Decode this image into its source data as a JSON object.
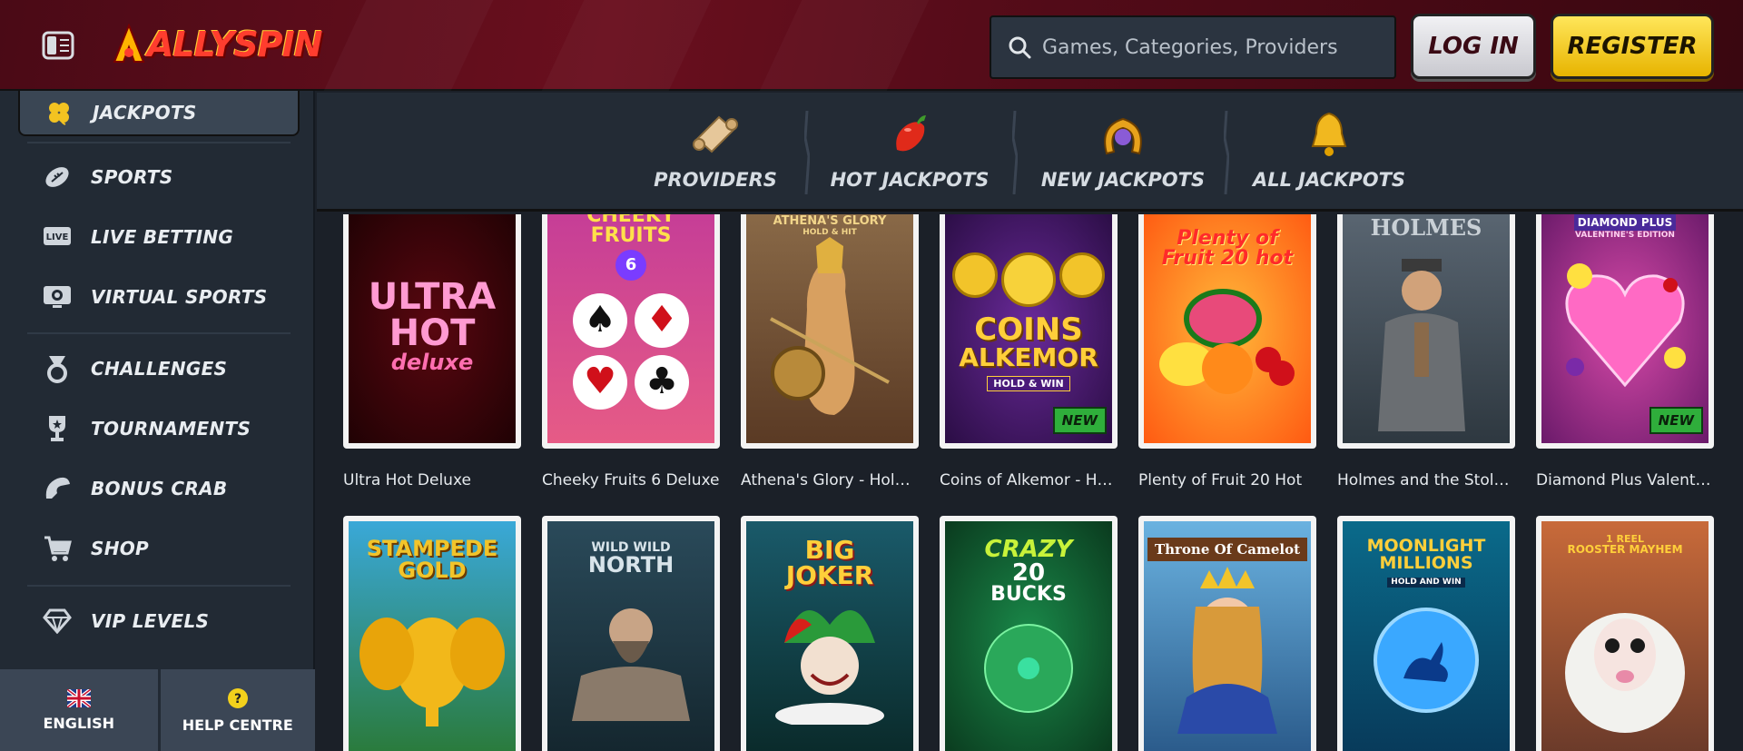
{
  "header": {
    "logo_text": "ALLYSPIN",
    "search_placeholder": "Games, Categories, Providers",
    "login_label": "LOG IN",
    "register_label": "REGISTER"
  },
  "sidebar": {
    "active_item": {
      "label": "JACKPOTS",
      "icon": "clover-icon"
    },
    "items": [
      {
        "label": "SPORTS",
        "icon": "football-icon"
      },
      {
        "label": "LIVE BETTING",
        "icon": "live-icon"
      },
      {
        "label": "VIRTUAL SPORTS",
        "icon": "virtual-sports-icon"
      },
      {
        "label": "CHALLENGES",
        "icon": "medal-icon"
      },
      {
        "label": "TOURNAMENTS",
        "icon": "trophy-icon"
      },
      {
        "label": "BONUS CRAB",
        "icon": "crab-claw-icon"
      },
      {
        "label": "SHOP",
        "icon": "cart-icon"
      },
      {
        "label": "VIP LEVELS",
        "icon": "diamond-icon"
      }
    ],
    "bottom": {
      "language_label": "ENGLISH",
      "help_label": "HELP CENTRE"
    }
  },
  "categories": [
    {
      "label": "PROVIDERS",
      "icon": "scroll-icon"
    },
    {
      "label": "HOT JACKPOTS",
      "icon": "chili-icon"
    },
    {
      "label": "NEW JACKPOTS",
      "icon": "horseshoe-icon"
    },
    {
      "label": "ALL JACKPOTS",
      "icon": "bell-icon"
    }
  ],
  "games_row1": [
    {
      "name": "Ultra Hot Deluxe",
      "art_line1": "ULTRA",
      "art_line2": "HOT",
      "art_line3": "deluxe"
    },
    {
      "name": "Cheeky Fruits 6 Deluxe",
      "art_line1": "CHEEKY",
      "art_line2": "FRUITS",
      "art_line3": "6"
    },
    {
      "name": "Athena's Glory - Hold ...",
      "art_line1": "ATHENA'S GLORY",
      "art_line2": "HOLD & HIT"
    },
    {
      "name": "Coins of Alkemor - HO...",
      "art_line1": "COINS",
      "art_line2": "ALKEMOR",
      "art_line3": "HOLD & WIN",
      "badge": "NEW"
    },
    {
      "name": "Plenty of Fruit 20 Hot",
      "art_line1": "Plenty of",
      "art_line2": "Fruit 20 hot"
    },
    {
      "name": "Holmes and the Stole...",
      "art_line1": "HOLMES"
    },
    {
      "name": "Diamond Plus Valenti...",
      "art_line1": "DIAMOND PLUS",
      "art_line2": "VALENTINE'S EDITION",
      "badge": "NEW"
    }
  ],
  "games_row2": [
    {
      "art_line1": "STAMPEDE",
      "art_line2": "GOLD"
    },
    {
      "art_line1": "WILD WILD",
      "art_line2": "NORTH"
    },
    {
      "art_line1": "BIG",
      "art_line2": "JOKER"
    },
    {
      "art_line1": "CRAZY",
      "art_line2": "20",
      "art_line3": "BUCKS"
    },
    {
      "art_line1": "Throne Of Camelot"
    },
    {
      "art_line1": "MOONLIGHT",
      "art_line2": "MILLIONS",
      "art_line3": "HOLD AND WIN"
    },
    {
      "art_line1": "1 REEL",
      "art_line2": "ROOSTER MAYHEM"
    }
  ]
}
